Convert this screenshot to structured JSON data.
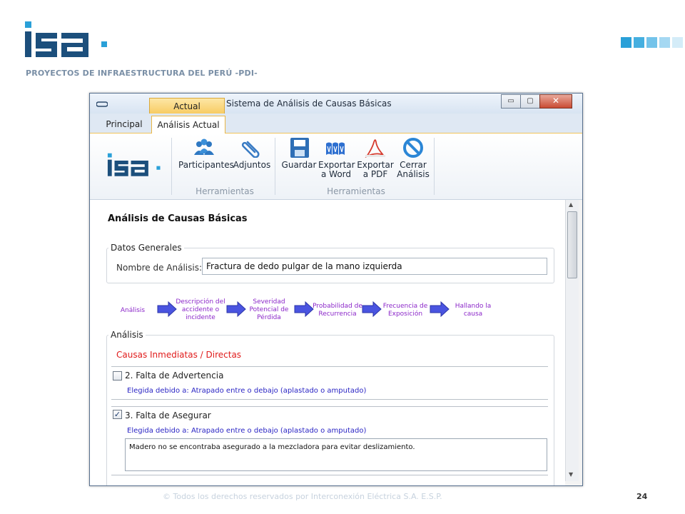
{
  "slide": {
    "logo_text": "isa",
    "subtitle": "PROYECTOS DE INFRAESTRUCTURA DEL PERÚ -PDI-",
    "footer": "© Todos los derechos reservados por Interconexión Eléctrica S.A. E.S.P.",
    "page_number": "24",
    "colors": {
      "brand_dark": "#1c4f7c",
      "brand_light": "#2aa0d8"
    }
  },
  "window": {
    "contextual_tab": "Actual",
    "title": "Sistema de Análisis de Causas Básicas",
    "controls": {
      "minimize": "▭",
      "maximize": "▢",
      "close": "✕"
    }
  },
  "tabs": [
    {
      "label": "Principal"
    },
    {
      "label": "Análisis Actual",
      "active": true
    }
  ],
  "ribbon": {
    "logo_text": "isa",
    "groups": [
      {
        "label": "Herramientas",
        "buttons": [
          {
            "label": "Participantes",
            "icon": "people-icon"
          },
          {
            "label": "Adjuntos",
            "icon": "paperclip-icon"
          }
        ]
      },
      {
        "label": "Herramientas",
        "buttons": [
          {
            "line1": "Guardar",
            "line2": "",
            "icon": "save-icon"
          },
          {
            "line1": "Exportar",
            "line2": "a Word",
            "icon": "word-icon"
          },
          {
            "line1": "Exportar",
            "line2": "a PDF",
            "icon": "pdf-icon"
          },
          {
            "line1": "Cerrar",
            "line2": "Análisis",
            "icon": "no-sign-icon"
          }
        ]
      }
    ]
  },
  "content": {
    "title": "Análisis de Causas Básicas",
    "general": {
      "legend": "Datos Generales",
      "name_label": "Nombre de Análisis:",
      "name_value": "Fractura de dedo pulgar de la mano izquierda"
    },
    "flow_steps": [
      {
        "l1": "Análisis",
        "l2": "",
        "l3": ""
      },
      {
        "l1": "Descripción del",
        "l2": "accidente o",
        "l3": "incidente"
      },
      {
        "l1": "Severidad",
        "l2": "Potencial de",
        "l3": "Pérdida"
      },
      {
        "l1": "Probabilidad de",
        "l2": "Recurrencia",
        "l3": ""
      },
      {
        "l1": "Frecuencia de",
        "l2": "Exposición",
        "l3": ""
      },
      {
        "l1": "Hallando la",
        "l2": "causa",
        "l3": ""
      }
    ],
    "analysis": {
      "legend": "Análisis",
      "section_title": "Causas Inmediatas / Directas",
      "items": [
        {
          "label": "2. Falta de Advertencia",
          "checked": false,
          "reason": "Elegida debido a: Atrapado entre o debajo (aplastado o amputado)"
        },
        {
          "label": "3. Falta de Asegurar",
          "checked": true,
          "reason": "Elegida debido a: Atrapado entre o debajo (aplastado o amputado)",
          "comment": "Madero no se encontraba asegurado a la mezcladora para evitar deslizamiento."
        }
      ]
    }
  }
}
